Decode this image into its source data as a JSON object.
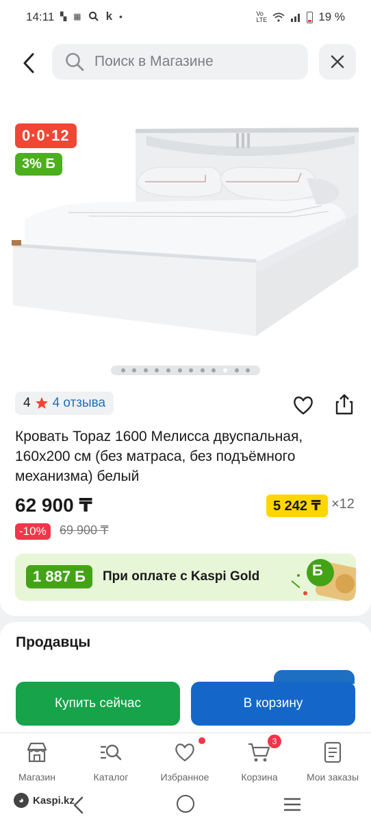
{
  "status_bar": {
    "time": "14:11",
    "battery": "19 %",
    "indicator_icons": [
      "vpn-icon",
      "bank-app-icon",
      "search-icon",
      "kaspi-k-icon",
      "dot-icon"
    ]
  },
  "header": {
    "search_placeholder": "Поиск в Магазине"
  },
  "gallery": {
    "timer_badge": "0·0·12",
    "bonus_badge": "3% Б",
    "total_images": 12,
    "active_index": 9
  },
  "product": {
    "rating": "4",
    "reviews_link": "4 отзыва",
    "title": "Кровать Topaz 1600 Мелисса двуспальная, 160х200 см (без матраса, без подъёмного механизма) белый",
    "price": "62 900 ₸",
    "monthly_payment": "5 242 ₸",
    "months": "×12",
    "discount": "-10%",
    "old_price": "69 900 ₸"
  },
  "kaspi_gold": {
    "bonus_amount": "1 887 Б",
    "text": "При оплате с Kaspi Gold",
    "deco_badge": "Б"
  },
  "sellers": {
    "heading": "Продавцы"
  },
  "actions": {
    "buy_now": "Купить сейчас",
    "add_to_cart": "В корзину"
  },
  "bottom_nav": [
    {
      "label": "Магазин",
      "icon": "store-icon"
    },
    {
      "label": "Каталог",
      "icon": "catalog-search-icon"
    },
    {
      "label": "Избранное",
      "icon": "heart-icon"
    },
    {
      "label": "Корзина",
      "icon": "cart-icon",
      "badge": "3"
    },
    {
      "label": "Мои заказы",
      "icon": "orders-icon"
    }
  ],
  "system_bar": {
    "brand": "Kaspi.kz"
  },
  "colors": {
    "primary_blue": "#1467c8",
    "buy_green": "#16a34a",
    "promo_red": "#f14635",
    "gold_bg": "#e8f6d8",
    "monthly_yellow": "#ffd600"
  }
}
